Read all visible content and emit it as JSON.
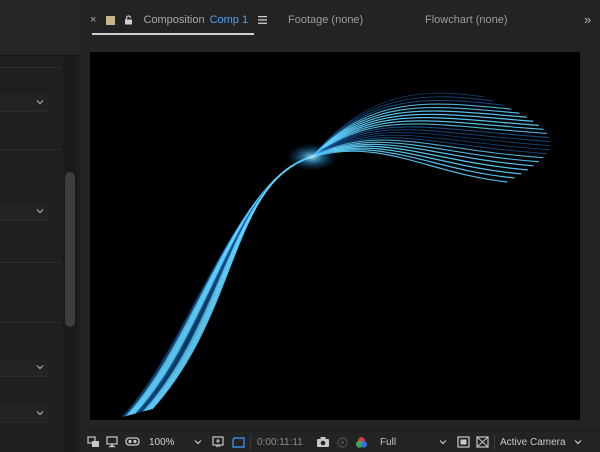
{
  "tabs": {
    "close_glyph": "×",
    "composition_label": "Composition",
    "composition_name": "Comp 1",
    "footage_label": "Footage (none)",
    "flowchart_label": "Flowchart (none)",
    "more_glyph": "»"
  },
  "toolbar": {
    "zoom": "100%",
    "timecode": "0:00:11:11",
    "resolution": "Full",
    "camera": "Active Camera"
  },
  "colors": {
    "accent_blue": "#4aa3f0",
    "comp_swatch": "#c8b48a",
    "viewer_bg": "#000000",
    "streak_glow": "#5fd2ff",
    "streak_base": "#1a5fa8"
  },
  "icons": [
    "close-icon",
    "composition-swatch-icon",
    "lock-icon",
    "panel-menu-icon",
    "overflow-chevron-icon",
    "region-of-interest-icon",
    "monitor-icon",
    "mask-visibility-icon",
    "zoom-chevron-icon",
    "safe-zones-icon",
    "transparency-grid-icon",
    "snapshot-camera-icon",
    "show-snapshot-icon",
    "color-channels-icon",
    "resolution-chevron-icon",
    "fast-preview-icon",
    "grid-toggle-icon",
    "camera-chevron-icon",
    "dropdown-chevron-icon"
  ]
}
